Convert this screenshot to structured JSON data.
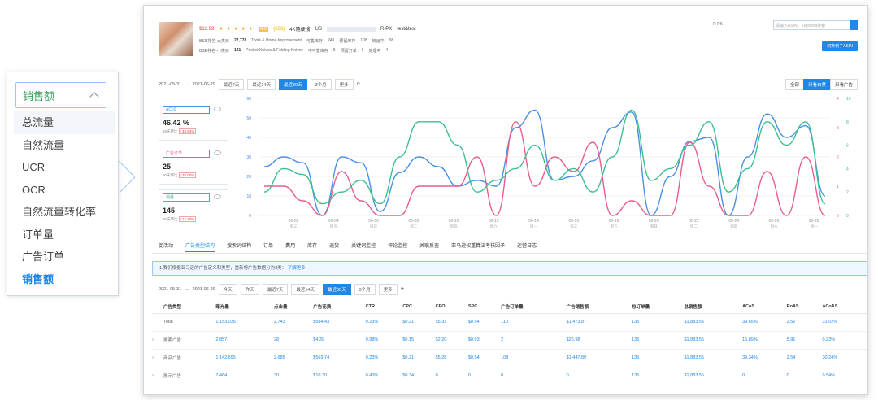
{
  "dropdown": {
    "selected": "销售额",
    "options": [
      "总流量",
      "自然流量",
      "UCR",
      "OCR",
      "自然流量转化率",
      "订单量",
      "广告订单",
      "销售额"
    ],
    "hover_index": 0,
    "active_index": 7
  },
  "product": {
    "price": "$12.99",
    "stars": "★ ★ ★ ★ ★",
    "rating": "4.6",
    "reviews": "(666)",
    "variant": "4K随便搜",
    "marketplace": "US",
    "rank_label1": "BSR排名-大类目",
    "rank1": "27,778",
    "cat1": "Tools & Home Improvement",
    "avail1_label": "可售库存",
    "avail1": "249",
    "reserved_label": "预留库存",
    "reserved": "108",
    "transit_label": "转运中",
    "transit": "98",
    "rank_label2": "BSR排名-小类目",
    "rank2": "141",
    "cat2": "Pocket Knives & Folding Knives",
    "unsell_label": "不可售库存",
    "unsell": "5",
    "preorder_label": "预留订单",
    "preorder": "6",
    "processing_label": "处理中",
    "processing": "4",
    "fc": "R-PK",
    "owner": "test&test"
  },
  "top": {
    "select": "R-PK",
    "search_placeholder": "请输入ASIN，Keyword搜索",
    "button": "切换到子ASIN"
  },
  "dates": {
    "start": "2021-05-31",
    "sep": "→",
    "end": "2021-06-29",
    "chips": [
      "最近7天",
      "最近14天",
      "最近30天",
      "3个月",
      "更多"
    ],
    "active": "最近30天",
    "right_chips": [
      "全部",
      "只看自然",
      "只看广告"
    ],
    "right_active": "只看自然"
  },
  "metrics": [
    {
      "select": "ACoS",
      "value": "46.42 %",
      "sub_label": "30天环比",
      "delta": "↑48.64%",
      "color": "#4a90e2"
    },
    {
      "select": "广告订单",
      "value": "25",
      "sub_label": "30天环比",
      "delta": "↑25.00%",
      "color": "#e85d8e"
    },
    {
      "select": "销量",
      "value": "145",
      "sub_label": "30天环比",
      "delta": "↑12.40%",
      "color": "#3cbf8f"
    }
  ],
  "chart_data": {
    "type": "line",
    "x": [
      "06-02",
      "06-04",
      "06-06",
      "06-08",
      "06-10",
      "06-12",
      "06-14",
      "06-16",
      "06-18",
      "06-20",
      "06-22",
      "06-24",
      "06-26",
      "06-28"
    ],
    "x_sub": [
      "周三",
      "周五",
      "周日",
      "周二",
      "周四",
      "周六",
      "周一",
      "周三",
      "周五",
      "周日",
      "周二",
      "周四",
      "周六",
      "周一"
    ],
    "y_left": [
      0,
      10,
      20,
      30,
      40,
      50,
      60
    ],
    "y_right1": [
      0,
      1,
      2,
      3,
      4
    ],
    "y_right2": [
      0,
      2,
      4,
      6,
      8,
      10
    ],
    "series": [
      {
        "color": "#4a90e2",
        "axis": "left",
        "values": [
          25,
          30,
          27,
          0,
          30,
          27,
          2,
          22,
          30,
          25,
          15,
          18,
          15,
          45,
          54,
          18,
          20,
          28,
          45,
          53,
          0,
          20,
          38,
          40,
          0,
          30,
          52,
          40,
          46,
          10
        ]
      },
      {
        "color": "#e85d8e",
        "axis": "right1",
        "values": [
          1,
          1,
          0.5,
          0,
          1.5,
          0.5,
          0,
          0,
          1,
          1,
          1,
          2,
          0,
          3.2,
          1,
          2,
          1.5,
          2.5,
          0,
          0.5,
          0,
          0,
          2.5,
          1,
          0,
          0,
          1.5,
          0,
          2,
          0
        ]
      },
      {
        "color": "#3cbf8f",
        "axis": "right2",
        "values": [
          2,
          4,
          3.5,
          1,
          2,
          3,
          1,
          5,
          8,
          8,
          6,
          2,
          3,
          4,
          6,
          3,
          4,
          2,
          5,
          9,
          3,
          4,
          6,
          8,
          2,
          4,
          8,
          6,
          8,
          1
        ]
      }
    ]
  },
  "tabs": {
    "items": [
      "促活动",
      "广告类型结构",
      "搜索词结构",
      "订单",
      "费用",
      "库存",
      "退货",
      "关键词监控",
      "评论监控",
      "关联反查",
      "亚马逊权重算法考核因子",
      "运营日志"
    ],
    "active": "广告类型结构"
  },
  "info": {
    "text": "1.我们根据亚马逊的广告定义和类型，重新将广告数据分为3类：",
    "link": "了解更多"
  },
  "dates2": {
    "start": "2021-05-31",
    "sep": "→",
    "end": "2021-06-29",
    "chips": [
      "今天",
      "昨天",
      "最近7天",
      "最近14天",
      "最近30天",
      "3个月",
      "更多"
    ],
    "active": "最近30天"
  },
  "table": {
    "headers": [
      "广告类型",
      "曝光量",
      "点击量",
      "广告花费",
      "CTR",
      "CPC",
      "CPO",
      "SPC",
      "广告订单量",
      "广告销售额",
      "总订单量",
      "总销售额",
      "ACoS",
      "RoAS",
      "ACoAS"
    ],
    "rows": [
      {
        "expand": "",
        "cells": [
          "Total",
          "1,153,036",
          "2,743",
          "$584.43",
          "0.23%",
          "$0.21",
          "$5.31",
          "$0.54",
          "110",
          "$1,473.87",
          "135",
          "$1,883.55",
          "39.65%",
          "2.52",
          "31.02%"
        ]
      },
      {
        "expand": "›",
        "cells": [
          "搜索广告",
          "2,857",
          "28",
          "$4.39",
          "0.98%",
          "$0.15",
          "$2.20",
          "$0.93",
          "2",
          "$25.98",
          "135",
          "$1,883.55",
          "16.89%",
          "5.91",
          "0.23%"
        ]
      },
      {
        "expand": "›",
        "cells": [
          "商品广告",
          "1,142,695",
          "2,685",
          "$569.74",
          "0.23%",
          "$0.21",
          "$5.28",
          "$0.54",
          "108",
          "$1,447.89",
          "135",
          "$1,883.55",
          "39.34%",
          "2.54",
          "30.24%"
        ]
      },
      {
        "expand": "›",
        "cells": [
          "展示广告",
          "7,484",
          "30",
          "$10.30",
          "0.40%",
          "$0.34",
          "0",
          "0",
          "0",
          "0",
          "135",
          "$1,883.55",
          "0",
          "0",
          "0.54%"
        ]
      }
    ]
  }
}
